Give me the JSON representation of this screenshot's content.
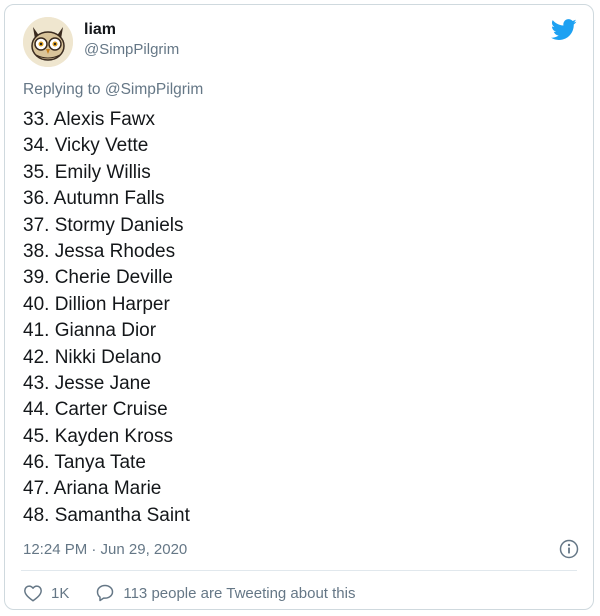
{
  "tweet": {
    "author": {
      "display_name": "liam",
      "handle": "@SimpPilgrim",
      "avatar_icon": "owl-avatar-icon"
    },
    "platform_icon": "twitter-bird-icon",
    "reply_prefix": "Replying to",
    "reply_to": "@SimpPilgrim",
    "list_items": [
      "33. Alexis Fawx",
      "34. Vicky Vette",
      "35. Emily Willis",
      "36. Autumn Falls",
      "37. Stormy Daniels",
      "38. Jessa Rhodes",
      "39. Cherie Deville",
      "40. Dillion Harper",
      "41. Gianna Dior",
      "42. Nikki Delano",
      "43. Jesse Jane",
      "44. Carter Cruise",
      "45. Kayden Kross",
      "46. Tanya Tate",
      "47. Ariana Marie",
      "48. Samantha Saint"
    ],
    "timestamp": "12:24 PM · Jun 29, 2020",
    "info_icon": "info-icon",
    "likes": "1K",
    "conversation": "113 people are Tweeting about this"
  },
  "colors": {
    "twitter_blue": "#1da1f2",
    "secondary_text": "#657786",
    "primary_text": "#14171a",
    "border": "#cfd9de"
  }
}
